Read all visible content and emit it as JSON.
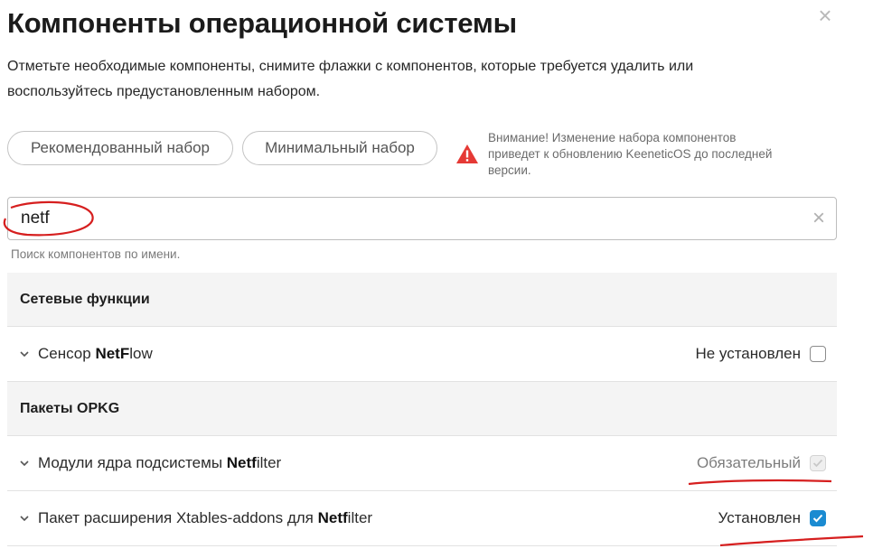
{
  "dialog": {
    "title": "Компоненты операционной системы",
    "description": "Отметьте необходимые компоненты, снимите флажки с компонентов, которые требуется удалить или воспользуйтесь предустановленным набором.",
    "close_icon": "close-icon"
  },
  "presets": {
    "recommended_label": "Рекомендованный набор",
    "minimal_label": "Минимальный набор"
  },
  "warning": {
    "icon": "warning-triangle-icon",
    "text": "Внимание! Изменение набора компонентов приведет к обновлению KeeneticOS до последней версии."
  },
  "search": {
    "value": "netf",
    "hint": "Поиск компонентов по имени."
  },
  "groups": [
    {
      "title": "Сетевые функции",
      "items": [
        {
          "pre": "Сенсор ",
          "match": "NetF",
          "post": "low",
          "status": "Не установлен",
          "checked": false,
          "disabled": false
        }
      ]
    },
    {
      "title": "Пакеты OPKG",
      "items": [
        {
          "pre": "Модули ядра подсистемы ",
          "match": "Netf",
          "post": "ilter",
          "status": "Обязательный",
          "checked": true,
          "disabled": true
        },
        {
          "pre": "Пакет расширения Xtables-addons для ",
          "match": "Netf",
          "post": "ilter",
          "status": "Установлен",
          "checked": true,
          "disabled": false
        }
      ]
    }
  ],
  "colors": {
    "accent": "#1b8bd1",
    "warning": "#e53935",
    "annotation": "#d61f1f"
  }
}
